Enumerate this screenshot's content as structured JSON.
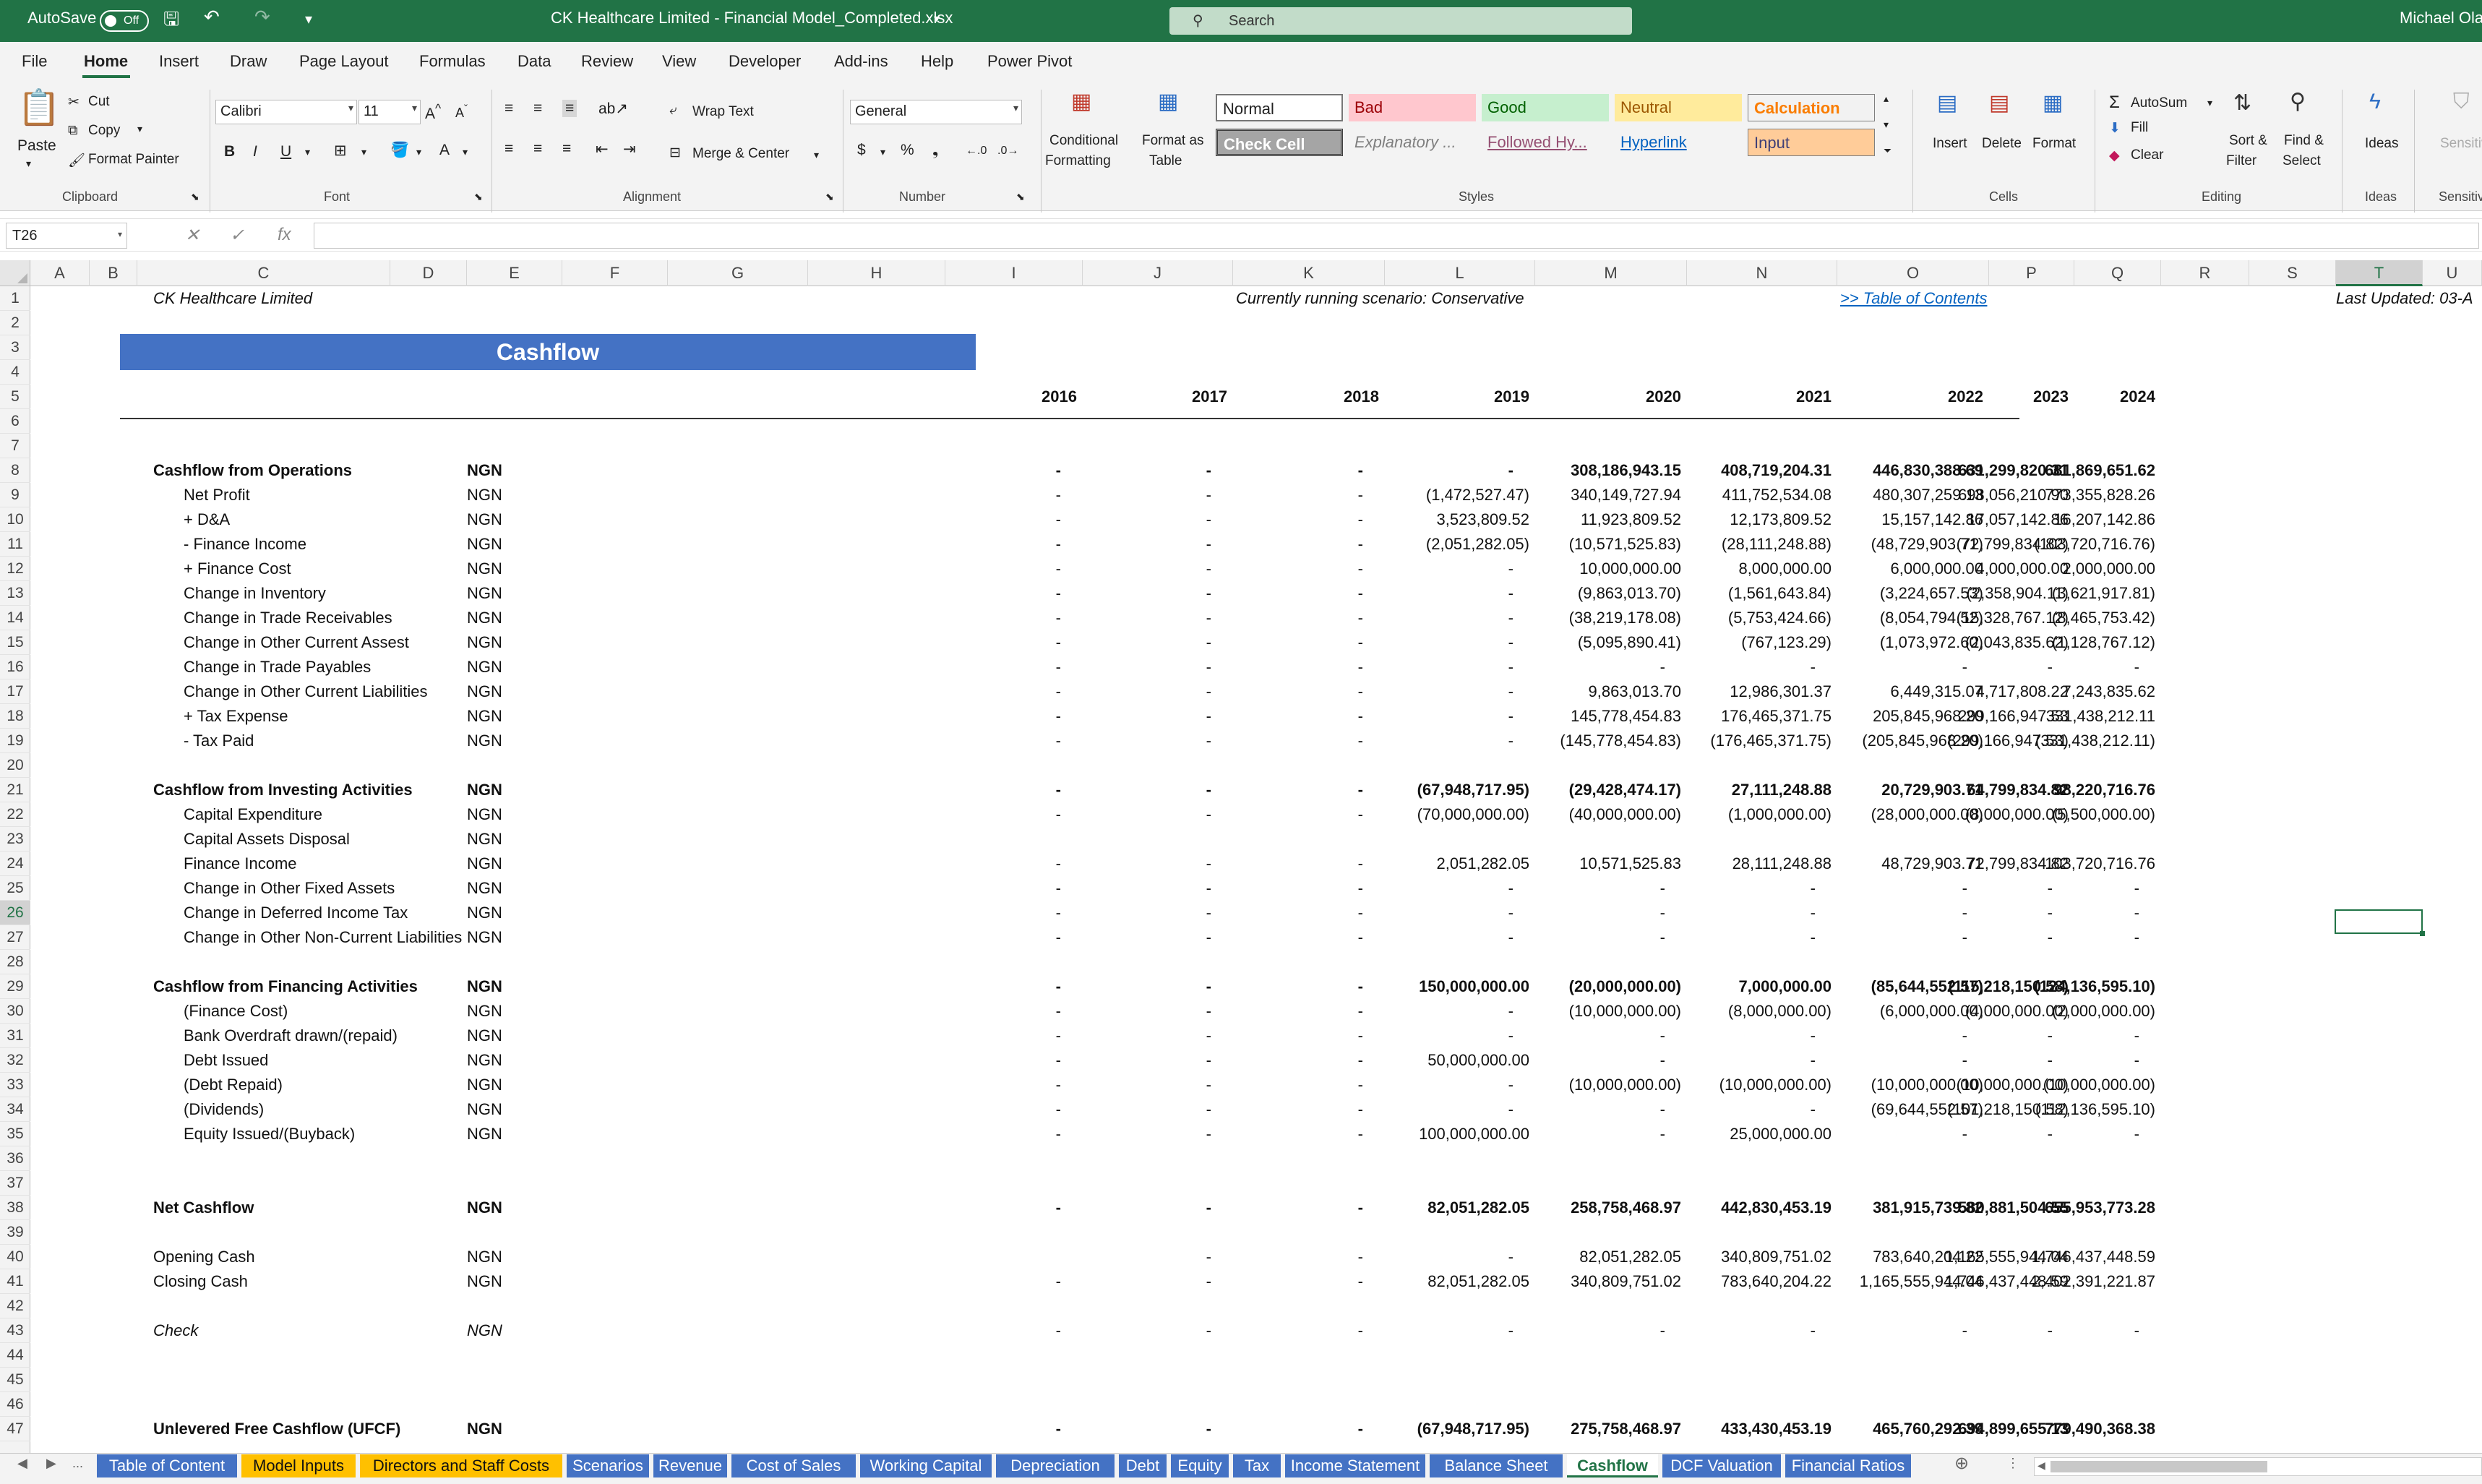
{
  "titlebar": {
    "autosave_label": "AutoSave",
    "autosave_state": "Off",
    "file_title": "CK Healthcare Limited - Financial Model_Completed.xlsx",
    "search_placeholder": "Search",
    "user": "Michael Ola"
  },
  "tabs": [
    "File",
    "Home",
    "Insert",
    "Draw",
    "Page Layout",
    "Formulas",
    "Data",
    "Review",
    "View",
    "Developer",
    "Add-ins",
    "Help",
    "Power Pivot"
  ],
  "ribbon": {
    "clipboard": {
      "paste": "Paste",
      "cut": "Cut",
      "copy": "Copy",
      "format_painter": "Format Painter",
      "label": "Clipboard"
    },
    "font": {
      "name": "Calibri",
      "size": "11",
      "label": "Font"
    },
    "alignment": {
      "wrap_text": "Wrap Text",
      "merge_center": "Merge & Center",
      "label": "Alignment"
    },
    "number": {
      "format": "General",
      "label": "Number"
    },
    "styles": {
      "conditional_formatting": "Conditional",
      "conditional_formatting2": "Formatting",
      "format_as_table": "Format as",
      "format_as_table2": "Table",
      "label": "Styles",
      "normal": "Normal",
      "bad": "Bad",
      "good": "Good",
      "neutral": "Neutral",
      "calculation": "Calculation",
      "check_cell": "Check Cell",
      "explanatory": "Explanatory ...",
      "followed": "Followed Hy...",
      "hyperlink": "Hyperlink",
      "input": "Input"
    },
    "cells": {
      "insert": "Insert",
      "delete": "Delete",
      "format": "Format",
      "label": "Cells"
    },
    "editing": {
      "autosum": "AutoSum",
      "fill": "Fill",
      "clear": "Clear",
      "sort_filter": "Sort &",
      "sort_filter2": "Filter",
      "find_select": "Find &",
      "find_select2": "Select",
      "label": "Editing"
    },
    "ideas": {
      "ideas": "Ideas",
      "label": "Ideas"
    },
    "sensitivity": {
      "label": "Sensitiv",
      "button": "Sensitiv"
    }
  },
  "formula_bar": {
    "name_box": "T26",
    "fx": "fx"
  },
  "columns": [
    "A",
    "B",
    "C",
    "D",
    "E",
    "F",
    "G",
    "H",
    "I",
    "J",
    "K",
    "L",
    "M",
    "N",
    "O",
    "P",
    "Q",
    "R",
    "S",
    "T",
    "U"
  ],
  "rows": [
    "1",
    "2",
    "3",
    "4",
    "5",
    "6",
    "7",
    "8",
    "9",
    "10",
    "11",
    "12",
    "13",
    "14",
    "15",
    "16",
    "17",
    "18",
    "19",
    "20",
    "21",
    "22",
    "23",
    "24",
    "25",
    "26",
    "27",
    "28",
    "29",
    "30",
    "31",
    "32",
    "33",
    "34",
    "35",
    "36",
    "37",
    "38",
    "39",
    "40",
    "41",
    "42",
    "43",
    "44",
    "45",
    "46",
    "47"
  ],
  "sheet": {
    "company": "CK Healthcare Limited",
    "scenario": "Currently running scenario: Conservative",
    "toc_link": ">> Table of Contents",
    "last_updated": "Last Updated: 03-A",
    "banner": "Cashflow",
    "years": [
      "2016",
      "2017",
      "2018",
      "2019",
      "2020",
      "2021",
      "2022",
      "2023",
      "2024"
    ],
    "lines": [
      {
        "row": 8,
        "label": "Cashflow from Operations",
        "unit": "NGN",
        "bold": true,
        "v": [
          "-",
          "-",
          "-",
          "-",
          "308,186,943.15",
          "408,719,204.31",
          "446,830,388.69",
          "631,299,820.31",
          "681,869,651.62"
        ]
      },
      {
        "row": 9,
        "label": "Net Profit",
        "unit": "NGN",
        "indent": true,
        "v": [
          "-",
          "-",
          "-",
          "(1,472,527.47)",
          "340,149,727.94",
          "411,752,534.08",
          "480,307,259.13",
          "698,056,210.90",
          "773,355,828.26"
        ]
      },
      {
        "row": 10,
        "label": "+ D&A",
        "unit": "NGN",
        "indent": true,
        "v": [
          "-",
          "-",
          "-",
          "3,523,809.52",
          "11,923,809.52",
          "12,173,809.52",
          "15,157,142.86",
          "17,057,142.86",
          "16,207,142.86"
        ]
      },
      {
        "row": 11,
        "label": "- Finance Income",
        "unit": "NGN",
        "indent": true,
        "v": [
          "-",
          "-",
          "-",
          "(2,051,282.05)",
          "(10,571,525.83)",
          "(28,111,248.88)",
          "(48,729,903.71)",
          "(72,799,834.82)",
          "(103,720,716.76)"
        ]
      },
      {
        "row": 12,
        "label": "+ Finance Cost",
        "unit": "NGN",
        "indent": true,
        "v": [
          "-",
          "-",
          "-",
          "-",
          "10,000,000.00",
          "8,000,000.00",
          "6,000,000.00",
          "4,000,000.00",
          "2,000,000.00"
        ]
      },
      {
        "row": 13,
        "label": "Change in Inventory",
        "unit": "NGN",
        "indent": true,
        "v": [
          "-",
          "-",
          "-",
          "-",
          "(9,863,013.70)",
          "(1,561,643.84)",
          "(3,224,657.53)",
          "(2,358,904.11)",
          "(3,621,917.81)"
        ]
      },
      {
        "row": 14,
        "label": "Change in Trade Receivables",
        "unit": "NGN",
        "indent": true,
        "v": [
          "-",
          "-",
          "-",
          "-",
          "(38,219,178.08)",
          "(5,753,424.66)",
          "(8,054,794.52)",
          "(15,328,767.12)",
          "(8,465,753.42)"
        ]
      },
      {
        "row": 15,
        "label": "Change in Other Current Assest",
        "unit": "NGN",
        "indent": true,
        "v": [
          "-",
          "-",
          "-",
          "-",
          "(5,095,890.41)",
          "(767,123.29)",
          "(1,073,972.60)",
          "(2,043,835.62)",
          "(1,128,767.12)"
        ]
      },
      {
        "row": 16,
        "label": "Change in Trade Payables",
        "unit": "NGN",
        "indent": true,
        "v": [
          "-",
          "-",
          "-",
          "-",
          "-",
          "-",
          "-",
          "-",
          "-"
        ]
      },
      {
        "row": 17,
        "label": "Change in Other Current Liabilities",
        "unit": "NGN",
        "indent": true,
        "v": [
          "-",
          "-",
          "-",
          "-",
          "9,863,013.70",
          "12,986,301.37",
          "6,449,315.07",
          "4,717,808.22",
          "7,243,835.62"
        ]
      },
      {
        "row": 18,
        "label": "+ Tax Expense",
        "unit": "NGN",
        "indent": true,
        "v": [
          "-",
          "-",
          "-",
          "-",
          "145,778,454.83",
          "176,465,371.75",
          "205,845,968.20",
          "299,166,947.53",
          "331,438,212.11"
        ]
      },
      {
        "row": 19,
        "label": "- Tax Paid",
        "unit": "NGN",
        "indent": true,
        "v": [
          "-",
          "-",
          "-",
          "-",
          "(145,778,454.83)",
          "(176,465,371.75)",
          "(205,845,968.20)",
          "(299,166,947.53)",
          "(331,438,212.11)"
        ]
      },
      {
        "row": 21,
        "label": "Cashflow from Investing Activities",
        "unit": "NGN",
        "bold": true,
        "v": [
          "-",
          "-",
          "-",
          "(67,948,717.95)",
          "(29,428,474.17)",
          "27,111,248.88",
          "20,729,903.71",
          "64,799,834.82",
          "98,220,716.76"
        ]
      },
      {
        "row": 22,
        "label": "Capital Expenditure",
        "unit": "NGN",
        "indent": true,
        "v": [
          "-",
          "-",
          "-",
          "(70,000,000.00)",
          "(40,000,000.00)",
          "(1,000,000.00)",
          "(28,000,000.00)",
          "(8,000,000.00)",
          "(5,500,000.00)"
        ]
      },
      {
        "row": 23,
        "label": "Capital Assets Disposal",
        "unit": "NGN",
        "indent": true,
        "v": [
          "",
          "",
          "",
          "",
          "",
          "",
          "",
          "",
          ""
        ]
      },
      {
        "row": 24,
        "label": "Finance Income",
        "unit": "NGN",
        "indent": true,
        "v": [
          "-",
          "-",
          "-",
          "2,051,282.05",
          "10,571,525.83",
          "28,111,248.88",
          "48,729,903.71",
          "72,799,834.82",
          "103,720,716.76"
        ]
      },
      {
        "row": 25,
        "label": "Change in Other Fixed Assets",
        "unit": "NGN",
        "indent": true,
        "v": [
          "-",
          "-",
          "-",
          "-",
          "-",
          "-",
          "-",
          "-",
          "-"
        ]
      },
      {
        "row": 26,
        "label": "Change in Deferred Income Tax",
        "unit": "NGN",
        "indent": true,
        "v": [
          "-",
          "-",
          "-",
          "-",
          "-",
          "-",
          "-",
          "-",
          "-"
        ]
      },
      {
        "row": 27,
        "label": "Change in Other Non-Current Liabilities",
        "unit": "NGN",
        "indent": true,
        "v": [
          "-",
          "-",
          "-",
          "-",
          "-",
          "-",
          "-",
          "-",
          "-"
        ]
      },
      {
        "row": 29,
        "label": "Cashflow from Financing Activities",
        "unit": "NGN",
        "bold": true,
        "v": [
          "-",
          "-",
          "-",
          "150,000,000.00",
          "(20,000,000.00)",
          "7,000,000.00",
          "(85,644,552.57)",
          "(115,218,150.58)",
          "(124,136,595.10)"
        ]
      },
      {
        "row": 30,
        "label": "(Finance Cost)",
        "unit": "NGN",
        "indent": true,
        "v": [
          "-",
          "-",
          "-",
          "-",
          "(10,000,000.00)",
          "(8,000,000.00)",
          "(6,000,000.00)",
          "(4,000,000.00)",
          "(2,000,000.00)"
        ]
      },
      {
        "row": 31,
        "label": "Bank Overdraft drawn/(repaid)",
        "unit": "NGN",
        "indent": true,
        "v": [
          "-",
          "-",
          "-",
          "-",
          "-",
          "-",
          "-",
          "-",
          "-"
        ]
      },
      {
        "row": 32,
        "label": "Debt Issued",
        "unit": "NGN",
        "indent": true,
        "v": [
          "-",
          "-",
          "-",
          "50,000,000.00",
          "-",
          "-",
          "-",
          "-",
          "-"
        ]
      },
      {
        "row": 33,
        "label": "(Debt Repaid)",
        "unit": "NGN",
        "indent": true,
        "v": [
          "-",
          "-",
          "-",
          "-",
          "(10,000,000.00)",
          "(10,000,000.00)",
          "(10,000,000.00)",
          "(10,000,000.00)",
          "(10,000,000.00)"
        ]
      },
      {
        "row": 34,
        "label": "(Dividends)",
        "unit": "NGN",
        "indent": true,
        "v": [
          "-",
          "-",
          "-",
          "-",
          "-",
          "-",
          "(69,644,552.57)",
          "(101,218,150.58)",
          "(112,136,595.10)"
        ]
      },
      {
        "row": 35,
        "label": "Equity Issued/(Buyback)",
        "unit": "NGN",
        "indent": true,
        "v": [
          "-",
          "-",
          "-",
          "100,000,000.00",
          "-",
          "25,000,000.00",
          "-",
          "-",
          "-"
        ]
      },
      {
        "row": 38,
        "label": "Net Cashflow",
        "unit": "NGN",
        "bold": true,
        "v": [
          "-",
          "-",
          "-",
          "82,051,282.05",
          "258,758,468.97",
          "442,830,453.19",
          "381,915,739.82",
          "580,881,504.55",
          "655,953,773.28"
        ]
      },
      {
        "row": 40,
        "label": "Opening Cash",
        "unit": "NGN",
        "v": [
          "",
          "-",
          "-",
          "-",
          "82,051,282.05",
          "340,809,751.02",
          "783,640,204.22",
          "1,165,555,944.04",
          "1,746,437,448.59"
        ]
      },
      {
        "row": 41,
        "label": "Closing Cash",
        "unit": "NGN",
        "v": [
          "-",
          "-",
          "-",
          "82,051,282.05",
          "340,809,751.02",
          "783,640,204.22",
          "1,165,555,944.04",
          "1,746,437,448.59",
          "2,402,391,221.87"
        ]
      },
      {
        "row": 43,
        "label": "Check",
        "unit": "NGN",
        "italic": true,
        "v": [
          "-",
          "-",
          "-",
          "-",
          "-",
          "-",
          "-",
          "-",
          "-"
        ]
      },
      {
        "row": 47,
        "label": "Unlevered Free Cashflow (UFCF)",
        "unit": "NGN",
        "bold": true,
        "v": [
          "-",
          "-",
          "-",
          "(67,948,717.95)",
          "275,758,468.97",
          "433,430,453.19",
          "465,760,292.39",
          "694,899,655.13",
          "779,490,368.38"
        ]
      }
    ]
  },
  "sheet_tabs": [
    {
      "name": "Table of Content",
      "color": "#4472c4"
    },
    {
      "name": "Model Inputs",
      "color": "#ffc000"
    },
    {
      "name": "Directors and Staff Costs",
      "color": "#ffc000"
    },
    {
      "name": "Scenarios",
      "color": "#4472c4"
    },
    {
      "name": "Revenue",
      "color": "#4472c4"
    },
    {
      "name": "Cost of Sales",
      "color": "#4472c4"
    },
    {
      "name": "Working Capital",
      "color": "#4472c4"
    },
    {
      "name": "Depreciation",
      "color": "#4472c4"
    },
    {
      "name": "Debt",
      "color": "#4472c4"
    },
    {
      "name": "Equity",
      "color": "#4472c4"
    },
    {
      "name": "Tax",
      "color": "#4472c4"
    },
    {
      "name": "Income Statement",
      "color": "#4472c4"
    },
    {
      "name": "Balance Sheet",
      "color": "#4472c4"
    },
    {
      "name": "Cashflow",
      "color": "#ffffff",
      "active": true
    },
    {
      "name": "DCF Valuation",
      "color": "#4472c4"
    },
    {
      "name": "Financial Ratios",
      "color": "#4472c4"
    }
  ],
  "sheet_nav": {
    "ellipsis": "...",
    "add": "⊕"
  },
  "colors": {
    "excel_green": "#217346",
    "banner_blue": "#4472c4",
    "tab_yellow": "#ffc000"
  }
}
